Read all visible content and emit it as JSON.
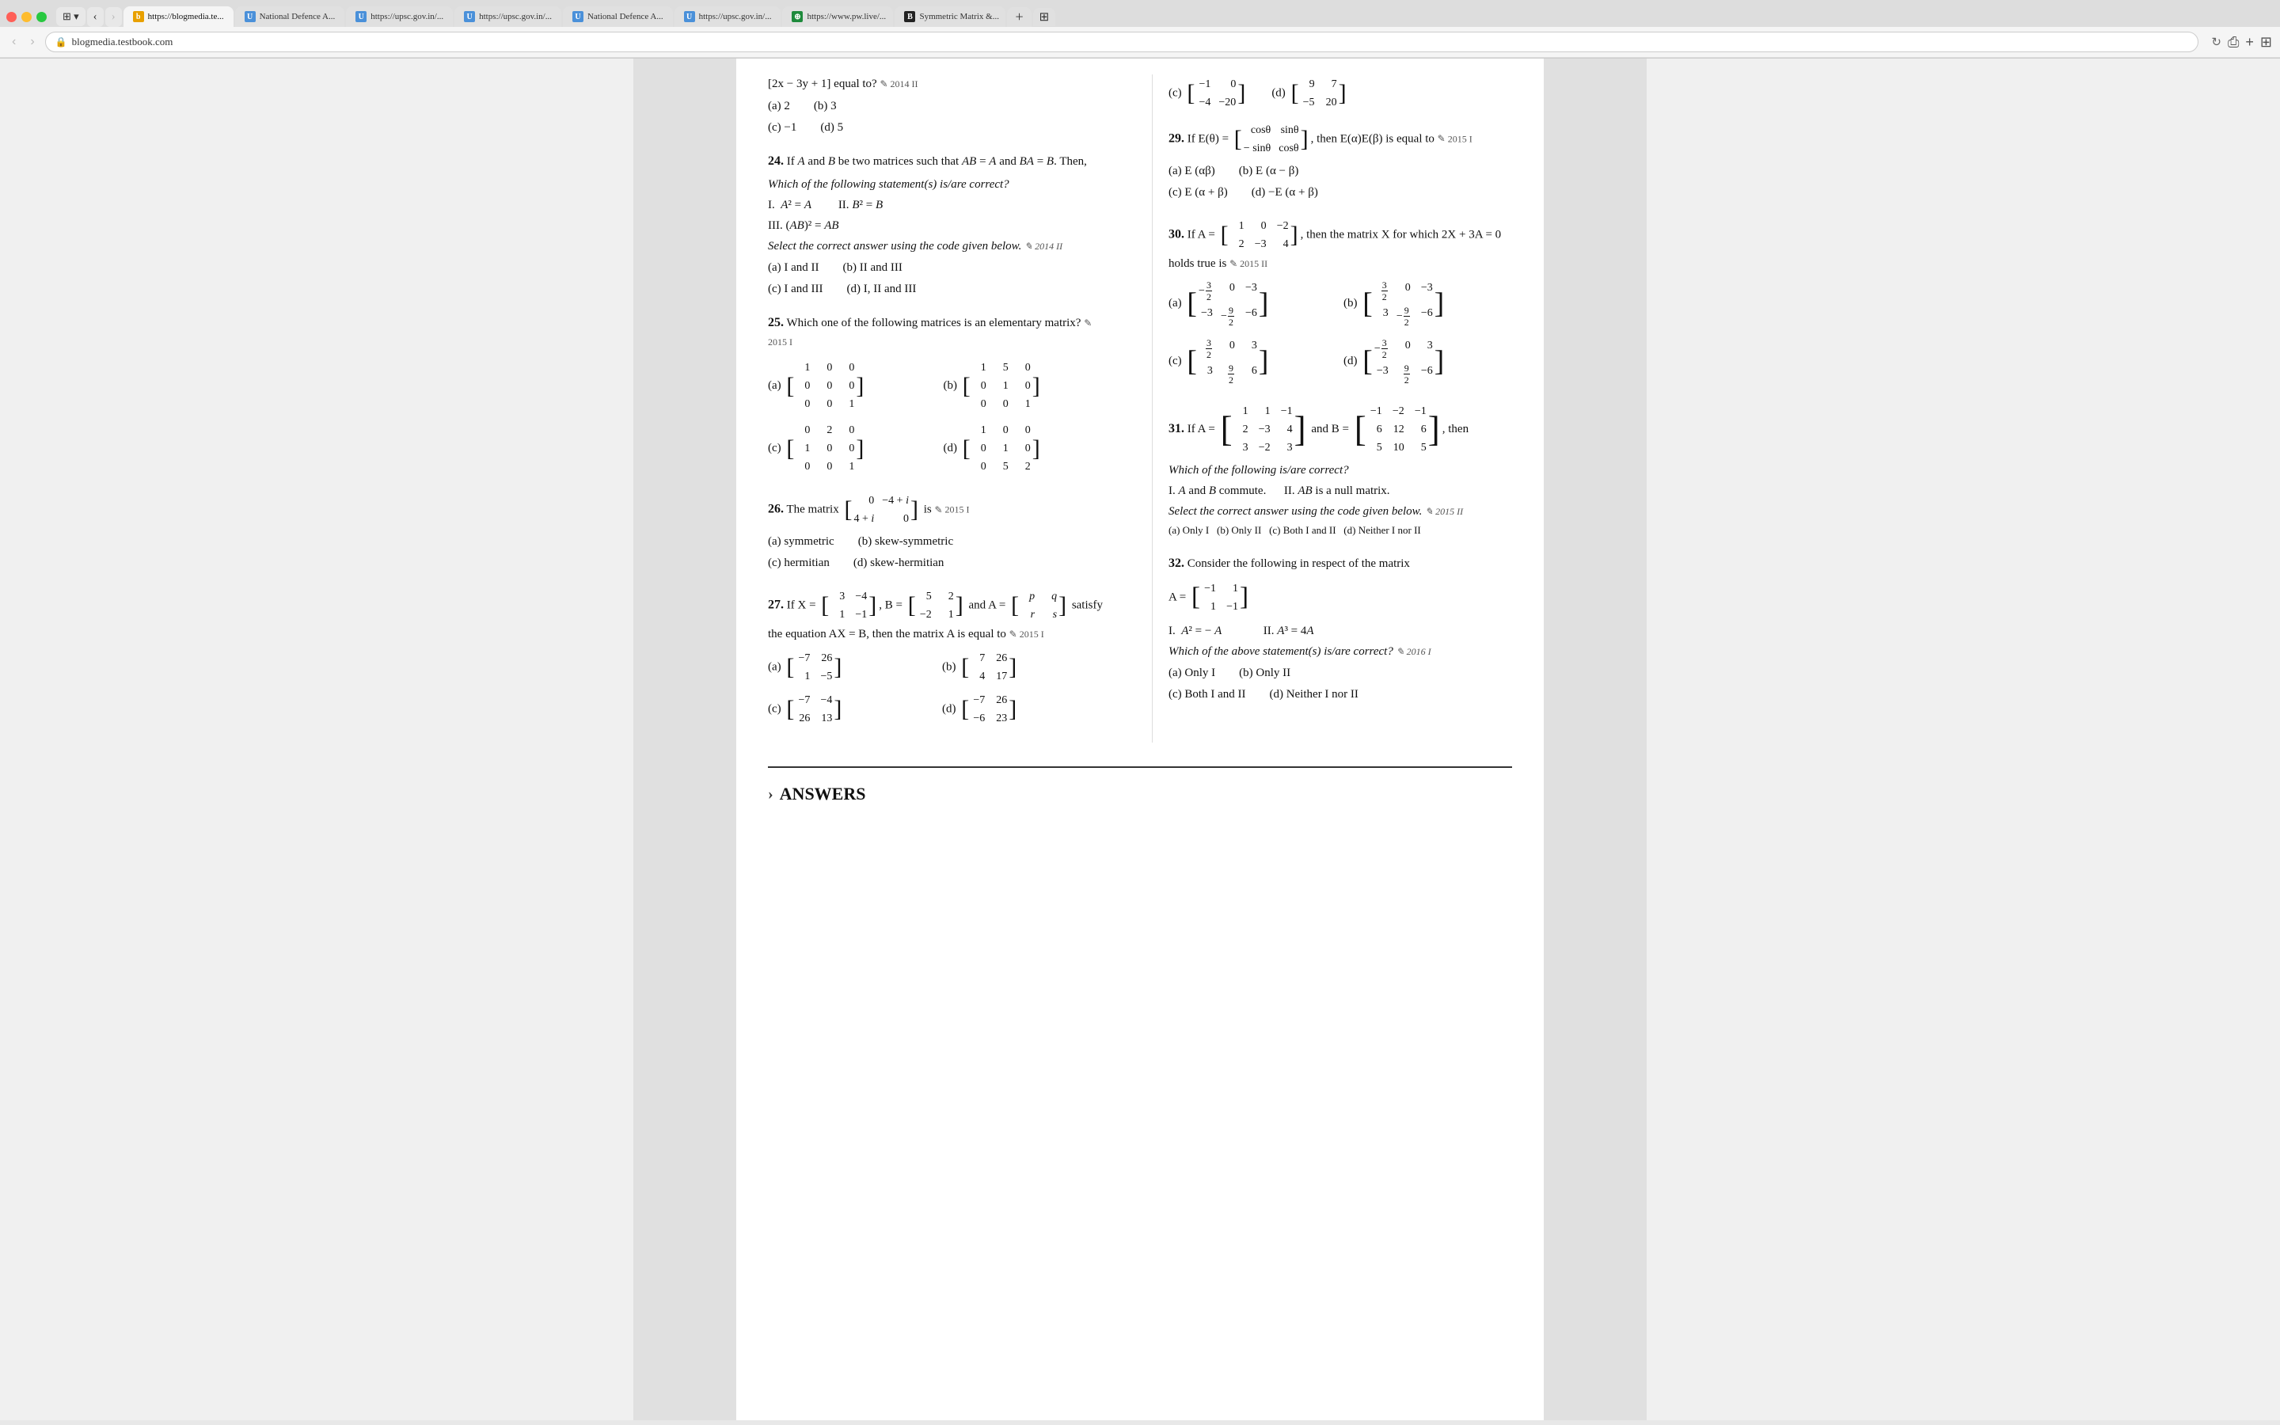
{
  "browser": {
    "tabs": [
      {
        "id": "t1",
        "favicon_class": "orange",
        "favicon_text": "b",
        "label": "https://blogmedia.te...",
        "active": true
      },
      {
        "id": "t2",
        "favicon_class": "blue",
        "favicon_text": "U",
        "label": "National Defence A..."
      },
      {
        "id": "t3",
        "favicon_class": "blue",
        "favicon_text": "U",
        "label": "https://upsc.gov.in/..."
      },
      {
        "id": "t4",
        "favicon_class": "blue",
        "favicon_text": "U",
        "label": "https://upsc.gov.in/..."
      },
      {
        "id": "t5",
        "favicon_class": "blue",
        "favicon_text": "U",
        "label": "National Defence A..."
      },
      {
        "id": "t6",
        "favicon_class": "blue",
        "favicon_text": "U",
        "label": "https://upsc.gov.in/..."
      },
      {
        "id": "t7",
        "favicon_class": "green",
        "favicon_text": "⊕",
        "label": "https://www.pw.live/..."
      },
      {
        "id": "t8",
        "favicon_class": "black",
        "favicon_text": "B",
        "label": "Symmetric Matrix &..."
      }
    ],
    "url": "blogmedia.testbook.com"
  },
  "questions": {
    "q24": {
      "num": "24.",
      "text": "If A and B be two matrices such that AB = A and BA = B. Then,",
      "subtext": "Which of the following statement(s) is/are correct?",
      "statements": [
        "I.  A² = A",
        "II. B² = B",
        "III. (AB)² = AB"
      ],
      "select_text": "Select the correct answer using the code given below.",
      "year": "2014 II",
      "options": [
        "(a) I and II",
        "(b) II and III",
        "(c) I and III",
        "(d) I, II and III"
      ]
    },
    "q25": {
      "num": "25.",
      "text": "Which one of the following matrices is an elementary matrix?",
      "year": "2015 I"
    },
    "q26": {
      "num": "26.",
      "text": "The matrix",
      "matrix_text": "is",
      "year": "2015 I",
      "options": [
        "(a) symmetric",
        "(b) skew-symmetric",
        "(c) hermitian",
        "(d) skew-hermitian"
      ]
    },
    "q27": {
      "num": "27.",
      "text_pre": "If X =",
      "text_mid1": ", B =",
      "text_mid2": "and A =",
      "text_post": "satisfy the equation AX = B, then the matrix A is equal to",
      "year": "2015 I"
    },
    "q29": {
      "num": "29.",
      "text_pre": "If E(θ) =",
      "text_post": ", then E(α)E(β) is equal to",
      "year": "2015 I",
      "options": [
        "(a) E(αβ)",
        "(b) E(α − β)",
        "(c) E(α + β)",
        "(d) −E(α + β)"
      ]
    },
    "q30": {
      "num": "30.",
      "text_pre": "If A =",
      "text_post": ", then the matrix X for which 2X + 3A = 0 holds true is",
      "year": "2015 II"
    },
    "q31": {
      "num": "31.",
      "text_pre": "If A =",
      "text_mid": "and B =",
      "text_post": ", then",
      "year": "2015 II",
      "subtext": "Which of the following is/are correct?",
      "statements": [
        "I. A and B commute.",
        "II. AB is a null matrix."
      ],
      "select_text": "Select the correct answer using the code given below.",
      "options_inline": "(a) Only I   (b) Only II   (c) Both I and II   (d) Neither I nor II"
    },
    "q32": {
      "num": "32.",
      "text": "Consider the following in respect of the matrix",
      "year": "2016 I",
      "statements": [
        "I.  A² = − A",
        "II. A³ = 4A"
      ],
      "subtext": "Which of the above statement(s) is/are correct?",
      "options": [
        "(a) Only I",
        "(b) Only II",
        "(c) Both I and II",
        "(d) Neither I nor II"
      ]
    }
  },
  "answers": {
    "title": "ANSWERS"
  }
}
